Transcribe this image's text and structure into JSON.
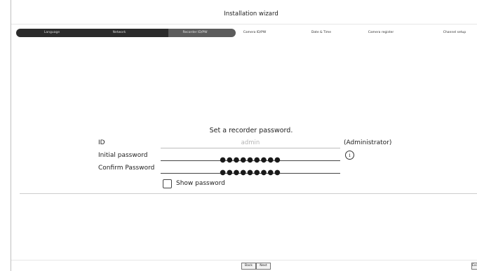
{
  "wizard": {
    "title": "Installation wizard"
  },
  "steps": [
    {
      "label": "Language",
      "state": "done"
    },
    {
      "label": "Network",
      "state": "done"
    },
    {
      "label": "Recorder ID/PW",
      "state": "current"
    },
    {
      "label": "Camera ID/PW",
      "state": "todo"
    },
    {
      "label": "Date & Time",
      "state": "todo"
    },
    {
      "label": "Camera register",
      "state": "todo"
    },
    {
      "label": "Channel setup",
      "state": "todo"
    }
  ],
  "form": {
    "heading": "Set a recorder password.",
    "id_label": "ID",
    "id_placeholder": "admin",
    "id_note": "(Administrator)",
    "initial_password_label": "Initial password",
    "initial_password_value": "●●●●●●●●●",
    "confirm_password_label": "Confirm Password",
    "confirm_password_value": "●●●●●●●●●",
    "show_password_label": "Show password",
    "show_password_checked": false,
    "info_icon": "info-icon"
  },
  "footer": {
    "back_label": "Back",
    "next_label": "Next",
    "exit_label": "Exit"
  },
  "colors": {
    "progress_done": "#2b2b2b",
    "progress_current": "#5c5c5c"
  }
}
